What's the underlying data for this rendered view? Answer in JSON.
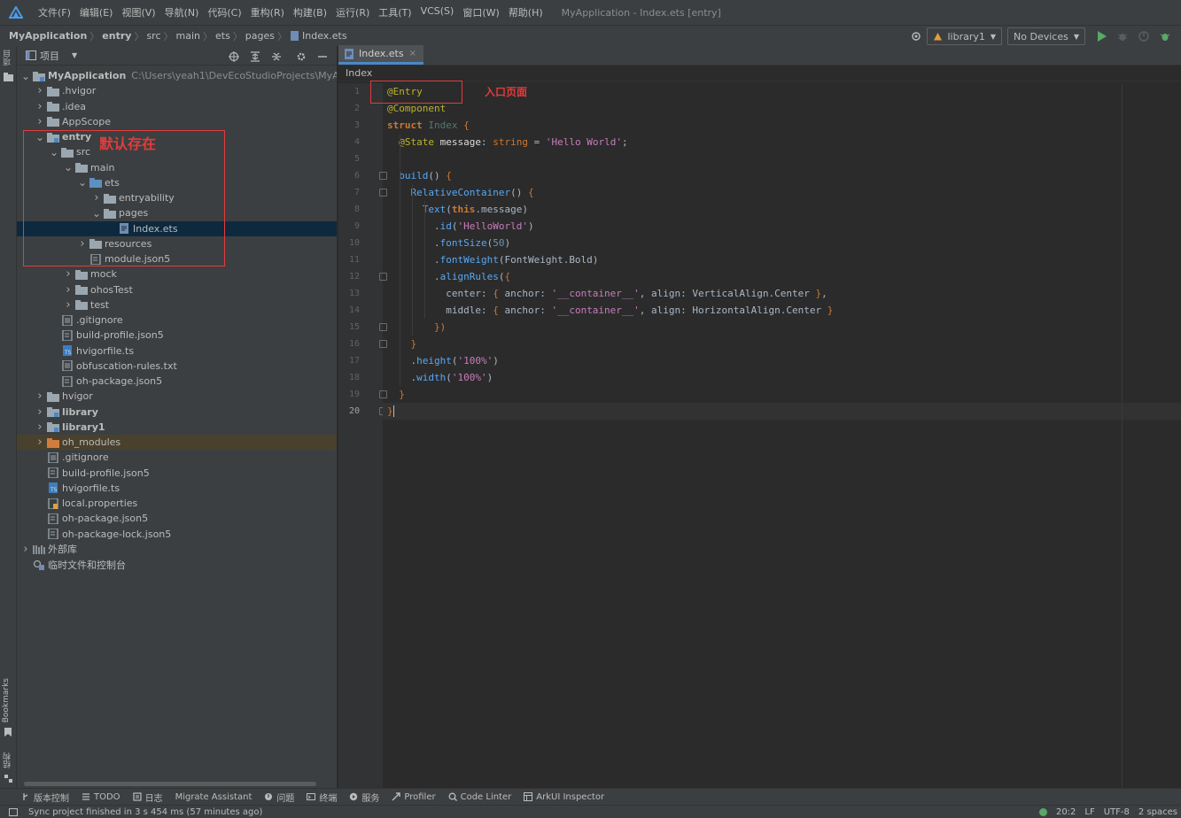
{
  "menubar": {
    "items": [
      "文件(F)",
      "编辑(E)",
      "视图(V)",
      "导航(N)",
      "代码(C)",
      "重构(R)",
      "构建(B)",
      "运行(R)",
      "工具(T)",
      "VCS(S)",
      "窗口(W)",
      "帮助(H)"
    ],
    "window_title": "MyApplication - Index.ets [entry]"
  },
  "breadcrumb": [
    "MyApplication",
    "entry",
    "src",
    "main",
    "ets",
    "pages",
    "Index.ets"
  ],
  "toolbar": {
    "module_combo": "library1",
    "device_combo": "No Devices"
  },
  "left_strip": {
    "project_tab": "项目",
    "bookmarks_tab": "Bookmarks",
    "structure_tab": "结构"
  },
  "project_panel": {
    "title": "项目",
    "tree": [
      {
        "label": "MyApplication",
        "path": "C:\\Users\\yeah1\\DevEcoStudioProjects\\MyApplica",
        "bold": true,
        "depth": 0,
        "chevron": "open",
        "icon": "module-folder"
      },
      {
        "label": ".hvigor",
        "depth": 1,
        "chevron": "closed",
        "icon": "folder"
      },
      {
        "label": ".idea",
        "depth": 1,
        "chevron": "closed",
        "icon": "folder"
      },
      {
        "label": "AppScope",
        "depth": 1,
        "chevron": "closed",
        "icon": "folder"
      },
      {
        "label": "entry",
        "bold": true,
        "depth": 1,
        "chevron": "open",
        "icon": "module-folder"
      },
      {
        "label": "src",
        "depth": 2,
        "chevron": "open",
        "icon": "folder"
      },
      {
        "label": "main",
        "depth": 3,
        "chevron": "open",
        "icon": "folder"
      },
      {
        "label": "ets",
        "depth": 4,
        "chevron": "open",
        "icon": "source-folder"
      },
      {
        "label": "entryability",
        "depth": 5,
        "chevron": "closed",
        "icon": "folder"
      },
      {
        "label": "pages",
        "depth": 5,
        "chevron": "open",
        "icon": "folder"
      },
      {
        "label": "Index.ets",
        "depth": 6,
        "chevron": "none",
        "icon": "ets-file",
        "selected": true
      },
      {
        "label": "resources",
        "depth": 4,
        "chevron": "closed",
        "icon": "folder"
      },
      {
        "label": "module.json5",
        "depth": 4,
        "chevron": "none",
        "icon": "json-file"
      },
      {
        "label": "mock",
        "depth": 3,
        "chevron": "closed",
        "icon": "folder"
      },
      {
        "label": "ohosTest",
        "depth": 3,
        "chevron": "closed",
        "icon": "folder"
      },
      {
        "label": "test",
        "depth": 3,
        "chevron": "closed",
        "icon": "folder"
      },
      {
        "label": ".gitignore",
        "depth": 2,
        "chevron": "none",
        "icon": "text-file"
      },
      {
        "label": "build-profile.json5",
        "depth": 2,
        "chevron": "none",
        "icon": "json-file"
      },
      {
        "label": "hvigorfile.ts",
        "depth": 2,
        "chevron": "none",
        "icon": "ts-file"
      },
      {
        "label": "obfuscation-rules.txt",
        "depth": 2,
        "chevron": "none",
        "icon": "text-file"
      },
      {
        "label": "oh-package.json5",
        "depth": 2,
        "chevron": "none",
        "icon": "json-file"
      },
      {
        "label": "hvigor",
        "depth": 1,
        "chevron": "closed",
        "icon": "folder"
      },
      {
        "label": "library",
        "bold": true,
        "depth": 1,
        "chevron": "closed",
        "icon": "module-folder"
      },
      {
        "label": "library1",
        "bold": true,
        "depth": 1,
        "chevron": "closed",
        "icon": "module-folder"
      },
      {
        "label": "oh_modules",
        "depth": 1,
        "chevron": "closed",
        "icon": "excluded-folder",
        "highlight": true
      },
      {
        "label": ".gitignore",
        "depth": 1,
        "chevron": "none",
        "icon": "text-file"
      },
      {
        "label": "build-profile.json5",
        "depth": 1,
        "chevron": "none",
        "icon": "json-file"
      },
      {
        "label": "hvigorfile.ts",
        "depth": 1,
        "chevron": "none",
        "icon": "ts-file"
      },
      {
        "label": "local.properties",
        "depth": 1,
        "chevron": "none",
        "icon": "properties-file"
      },
      {
        "label": "oh-package.json5",
        "depth": 1,
        "chevron": "none",
        "icon": "json-file"
      },
      {
        "label": "oh-package-lock.json5",
        "depth": 1,
        "chevron": "none",
        "icon": "json-file"
      },
      {
        "label": "外部库",
        "depth": 0,
        "chevron": "closed",
        "icon": "library-icon"
      },
      {
        "label": "临时文件和控制台",
        "depth": 0,
        "chevron": "none",
        "icon": "scratch-icon"
      }
    ]
  },
  "editor": {
    "tab_label": "Index.ets",
    "crumb": "Index",
    "lines": [
      [
        [
          "ann",
          "@Entry"
        ]
      ],
      [
        [
          "ann",
          "@Component"
        ]
      ],
      [
        [
          "kw",
          "struct "
        ],
        [
          "type",
          "Index "
        ],
        [
          "kw2",
          "{"
        ]
      ],
      [
        [
          "plain",
          "  "
        ],
        [
          "ann",
          "@State "
        ],
        [
          "white",
          "message"
        ],
        [
          "plain",
          ": "
        ],
        [
          "kw2",
          "string"
        ],
        [
          "plain",
          " = "
        ],
        [
          "str2",
          "'Hello World'"
        ],
        [
          "plain",
          ";"
        ]
      ],
      [
        [
          "plain",
          ""
        ]
      ],
      [
        [
          "plain",
          "  "
        ],
        [
          "method",
          "build"
        ],
        [
          "plain",
          "() "
        ],
        [
          "kw2",
          "{"
        ]
      ],
      [
        [
          "plain",
          "    "
        ],
        [
          "fn",
          "RelativeContainer"
        ],
        [
          "plain",
          "() "
        ],
        [
          "kw2",
          "{"
        ]
      ],
      [
        [
          "plain",
          "      "
        ],
        [
          "fn",
          "Text"
        ],
        [
          "plain",
          "("
        ],
        [
          "kw",
          "this"
        ],
        [
          "plain",
          ".message)"
        ]
      ],
      [
        [
          "plain",
          "        ."
        ],
        [
          "method",
          "id"
        ],
        [
          "plain",
          "("
        ],
        [
          "str2",
          "'HelloWorld'"
        ],
        [
          "plain",
          ")"
        ]
      ],
      [
        [
          "plain",
          "        ."
        ],
        [
          "method",
          "fontSize"
        ],
        [
          "plain",
          "("
        ],
        [
          "num",
          "50"
        ],
        [
          "plain",
          ")"
        ]
      ],
      [
        [
          "plain",
          "        ."
        ],
        [
          "method",
          "fontWeight"
        ],
        [
          "plain",
          "(FontWeight.Bold)"
        ]
      ],
      [
        [
          "plain",
          "        ."
        ],
        [
          "method",
          "alignRules"
        ],
        [
          "plain",
          "("
        ],
        [
          "kw2",
          "{"
        ]
      ],
      [
        [
          "plain",
          "          center: "
        ],
        [
          "kw2",
          "{ "
        ],
        [
          "plain",
          "anchor: "
        ],
        [
          "str2",
          "'__container__'"
        ],
        [
          "plain",
          ", align: VerticalAlign.Center "
        ],
        [
          "kw2",
          "}"
        ],
        [
          "plain",
          ","
        ]
      ],
      [
        [
          "plain",
          "          middle: "
        ],
        [
          "kw2",
          "{ "
        ],
        [
          "plain",
          "anchor: "
        ],
        [
          "str2",
          "'__container__'"
        ],
        [
          "plain",
          ", align: HorizontalAlign.Center "
        ],
        [
          "kw2",
          "}"
        ]
      ],
      [
        [
          "plain",
          "        "
        ],
        [
          "kw2",
          "})"
        ]
      ],
      [
        [
          "plain",
          "    "
        ],
        [
          "kw2",
          "}"
        ]
      ],
      [
        [
          "plain",
          "    ."
        ],
        [
          "method",
          "height"
        ],
        [
          "plain",
          "("
        ],
        [
          "str2",
          "'100%'"
        ],
        [
          "plain",
          ")"
        ]
      ],
      [
        [
          "plain",
          "    ."
        ],
        [
          "method",
          "width"
        ],
        [
          "plain",
          "("
        ],
        [
          "str2",
          "'100%'"
        ],
        [
          "plain",
          ")"
        ]
      ],
      [
        [
          "plain",
          "  "
        ],
        [
          "kw2",
          "}"
        ]
      ],
      [
        [
          "kw2",
          "}"
        ]
      ]
    ],
    "line_numbers": [
      "1",
      "2",
      "3",
      "4",
      "5",
      "6",
      "7",
      "8",
      "9",
      "10",
      "11",
      "12",
      "13",
      "14",
      "15",
      "16",
      "17",
      "18",
      "19",
      "20"
    ],
    "current_line": 20
  },
  "annotations": {
    "tree_note": "默认存在",
    "entry_note": "入口页面"
  },
  "bottom_tools": [
    "版本控制",
    "TODO",
    "日志",
    "Migrate Assistant",
    "问题",
    "终端",
    "服务",
    "Profiler",
    "Code Linter",
    "ArkUI Inspector"
  ],
  "status": {
    "message": "Sync project finished in 3 s 454 ms (57 minutes ago)",
    "position": "20:2",
    "line_sep": "LF",
    "encoding": "UTF-8",
    "indent": "2 spaces"
  },
  "colors": {
    "accent": "#4a88c7",
    "annotation_red": "#e33b3b",
    "run_green": "#59a869"
  }
}
